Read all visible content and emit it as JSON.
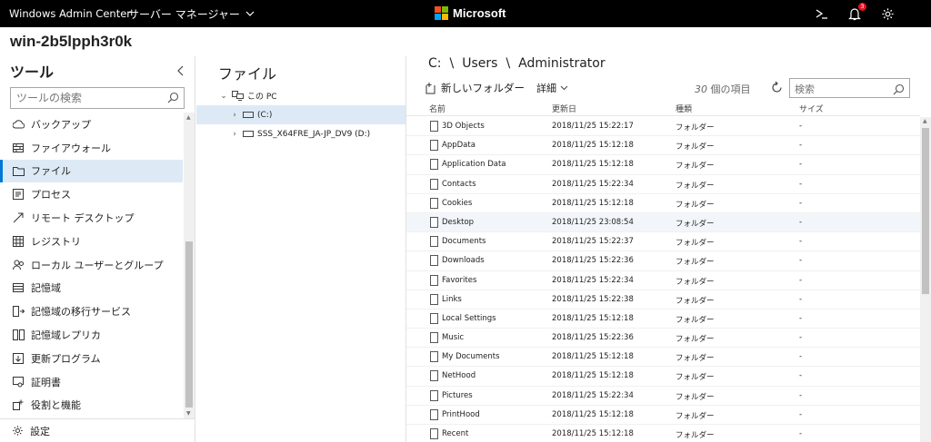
{
  "topbar": {
    "app_title": "Windows Admin Center",
    "server_manager_label": "サーバー マネージャー",
    "brand": "Microsoft",
    "notification_count": "3",
    "brand_colors": [
      "#f25022",
      "#7fba00",
      "#00a4ef",
      "#ffb900"
    ]
  },
  "server": {
    "name": "win-2b5lpph3r0k"
  },
  "tools": {
    "title": "ツール",
    "search_placeholder": "ツールの検索",
    "items": [
      {
        "label": "バックアップ",
        "icon": "backup-icon"
      },
      {
        "label": "ファイアウォール",
        "icon": "firewall-icon"
      },
      {
        "label": "ファイル",
        "icon": "folder-icon",
        "active": true
      },
      {
        "label": "プロセス",
        "icon": "process-icon"
      },
      {
        "label": "リモート デスクトップ",
        "icon": "remote-desktop-icon"
      },
      {
        "label": "レジストリ",
        "icon": "registry-icon"
      },
      {
        "label": "ローカル ユーザーとグループ",
        "icon": "users-icon"
      },
      {
        "label": "記憶域",
        "icon": "storage-icon"
      },
      {
        "label": "記憶域の移行サービス",
        "icon": "storage-migration-icon"
      },
      {
        "label": "記憶域レプリカ",
        "icon": "storage-replica-icon"
      },
      {
        "label": "更新プログラム",
        "icon": "updates-icon"
      },
      {
        "label": "証明書",
        "icon": "certificate-icon"
      },
      {
        "label": "役割と機能",
        "icon": "roles-icon"
      }
    ],
    "settings_label": "設定"
  },
  "tree": {
    "title": "ファイル",
    "root": "この PC",
    "drives": [
      "(C:)",
      "SSS_X64FRE_JA-JP_DV9 (D:)"
    ]
  },
  "files": {
    "breadcrumb": [
      "C:",
      "\\",
      "Users",
      "\\",
      "Administrator"
    ],
    "new_folder_label": "新しいフォルダー",
    "details_label": "詳細",
    "item_count": "30",
    "item_count_suffix": "個の項目",
    "search_placeholder": "検索",
    "columns": {
      "name": "名前",
      "modified": "更新日",
      "type": "種類",
      "size": "サイズ"
    },
    "rows": [
      {
        "name": "3D Objects",
        "modified": "2018/11/25 15:22:17",
        "type": "フォルダー",
        "size": "-"
      },
      {
        "name": "AppData",
        "modified": "2018/11/25 15:12:18",
        "type": "フォルダー",
        "size": "-"
      },
      {
        "name": "Application Data",
        "modified": "2018/11/25 15:12:18",
        "type": "フォルダー",
        "size": "-"
      },
      {
        "name": "Contacts",
        "modified": "2018/11/25 15:22:34",
        "type": "フォルダー",
        "size": "-"
      },
      {
        "name": "Cookies",
        "modified": "2018/11/25 15:12:18",
        "type": "フォルダー",
        "size": "-"
      },
      {
        "name": "Desktop",
        "modified": "2018/11/25 23:08:54",
        "type": "フォルダー",
        "size": "-"
      },
      {
        "name": "Documents",
        "modified": "2018/11/25 15:22:37",
        "type": "フォルダー",
        "size": "-"
      },
      {
        "name": "Downloads",
        "modified": "2018/11/25 15:22:36",
        "type": "フォルダー",
        "size": "-"
      },
      {
        "name": "Favorites",
        "modified": "2018/11/25 15:22:34",
        "type": "フォルダー",
        "size": "-"
      },
      {
        "name": "Links",
        "modified": "2018/11/25 15:22:38",
        "type": "フォルダー",
        "size": "-"
      },
      {
        "name": "Local Settings",
        "modified": "2018/11/25 15:12:18",
        "type": "フォルダー",
        "size": "-"
      },
      {
        "name": "Music",
        "modified": "2018/11/25 15:22:36",
        "type": "フォルダー",
        "size": "-"
      },
      {
        "name": "My Documents",
        "modified": "2018/11/25 15:12:18",
        "type": "フォルダー",
        "size": "-"
      },
      {
        "name": "NetHood",
        "modified": "2018/11/25 15:12:18",
        "type": "フォルダー",
        "size": "-"
      },
      {
        "name": "Pictures",
        "modified": "2018/11/25 15:22:34",
        "type": "フォルダー",
        "size": "-"
      },
      {
        "name": "PrintHood",
        "modified": "2018/11/25 15:12:18",
        "type": "フォルダー",
        "size": "-"
      },
      {
        "name": "Recent",
        "modified": "2018/11/25 15:12:18",
        "type": "フォルダー",
        "size": "-"
      }
    ]
  }
}
